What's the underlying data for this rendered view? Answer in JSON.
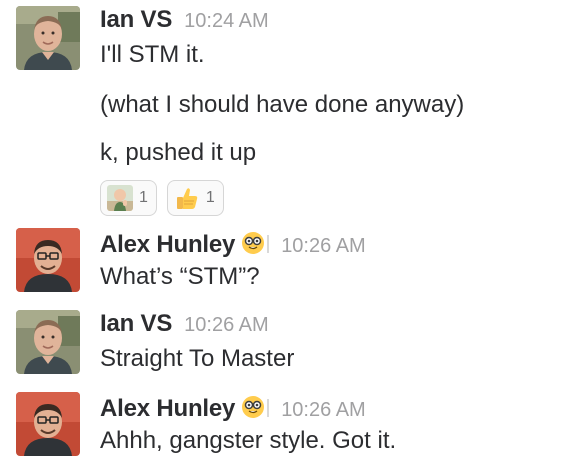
{
  "messages": [
    {
      "author": "Ian VS",
      "time": "10:24 AM",
      "avatar": "ian-avatar",
      "lines": [
        "I'll STM it.",
        "(what I should have done anyway)",
        "k, pushed it up"
      ],
      "reactions": [
        {
          "emoji": "success-kid-emoji",
          "count": "1"
        },
        {
          "emoji": "thumbsup-emoji",
          "count": "1"
        }
      ]
    },
    {
      "author": "Alex Hunley",
      "status_emoji": "nerd-face-emoji",
      "time": "10:26 AM",
      "avatar": "alex-avatar",
      "lines": [
        "What’s “STM”?"
      ]
    },
    {
      "author": "Ian VS",
      "time": "10:26 AM",
      "avatar": "ian-avatar",
      "lines": [
        "Straight To Master"
      ]
    },
    {
      "author": "Alex Hunley",
      "status_emoji": "nerd-face-emoji",
      "time": "10:26 AM",
      "avatar": "alex-avatar",
      "lines": [
        "Ahhh, gangster style. Got it."
      ]
    }
  ]
}
